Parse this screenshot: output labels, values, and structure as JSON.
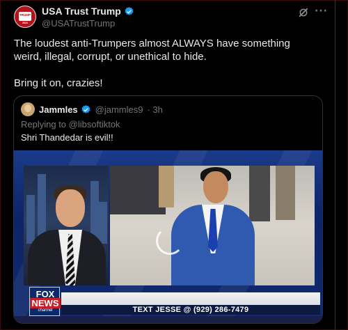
{
  "post": {
    "author_name": "USA Trust Trump",
    "author_handle": "@USATrustTrump",
    "avatar_text_top": "TRUMP",
    "avatar_text_bottom": "2024",
    "body_line1": "The loudest anti-Trumpers almost ALWAYS have something weird, illegal, corrupt, or unethical to hide.",
    "body_line2": "Bring it on, crazies!",
    "verified": true
  },
  "quoted": {
    "author_name": "Jammles",
    "author_handle": "@jammles9",
    "time": "· 3h",
    "reply_prefix": "Replying to",
    "reply_handle": "@libsoftiktok",
    "text": "Shri Thandedar is evil!!",
    "verified": true
  },
  "video": {
    "ticker_text": "TEXT JESSE @ (929) 286-7479",
    "logo_top": "FOX",
    "logo_bottom": "NEWS",
    "logo_sub": "channel"
  },
  "icons": [
    "verified-badge-icon",
    "grok-icon",
    "more-options-icon",
    "video-loading-icon"
  ],
  "colors": {
    "background": "#000000",
    "text": "#e7e9ea",
    "secondary": "#71767b",
    "verified": "#1d9bf0"
  }
}
